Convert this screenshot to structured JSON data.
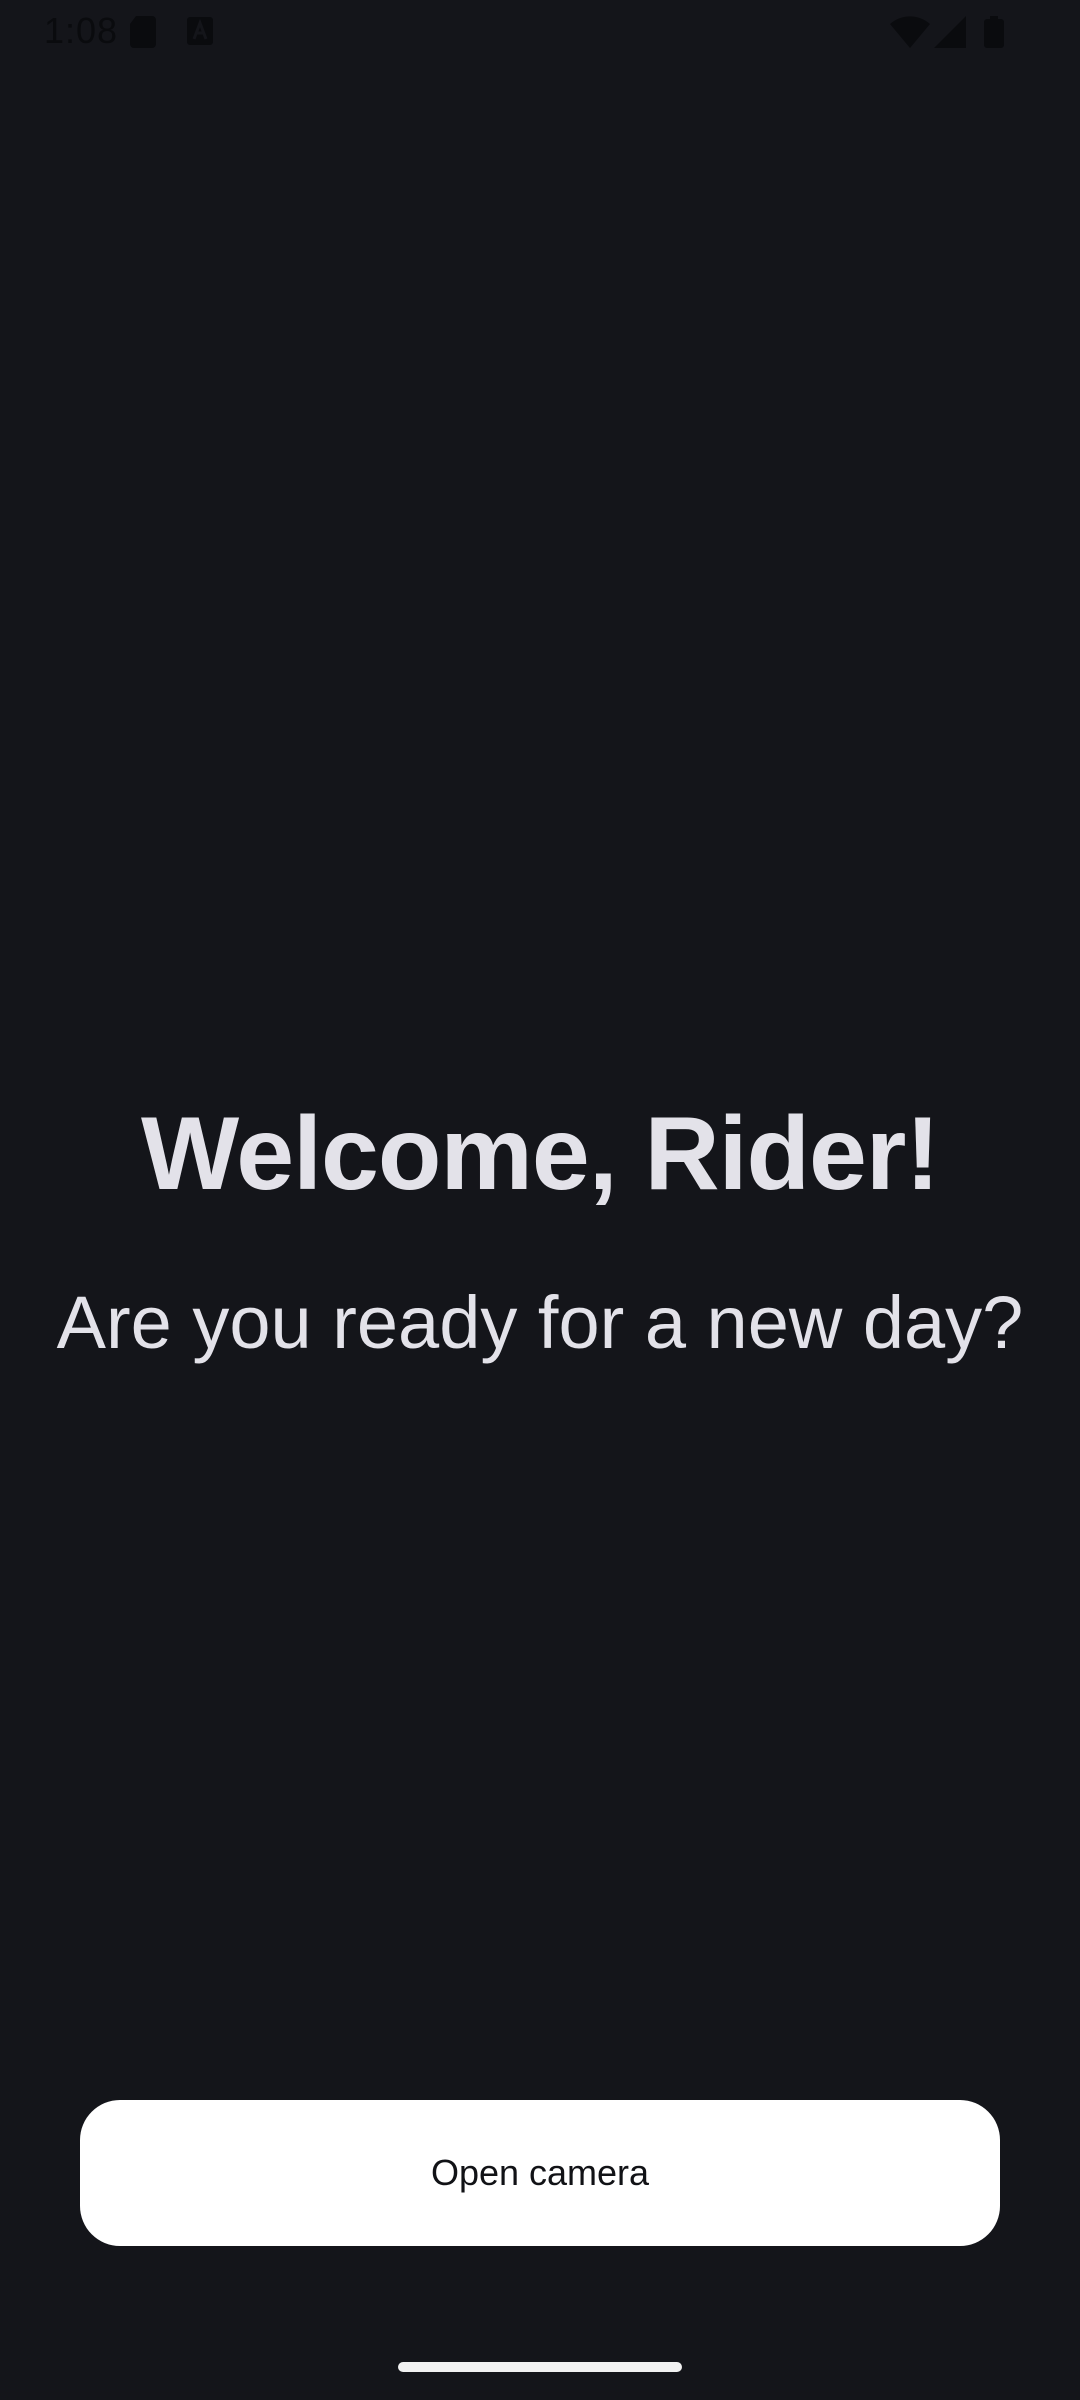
{
  "status_bar": {
    "time": "1:08",
    "icons": [
      "sim-card-icon",
      "app-notification-icon",
      "wifi-icon",
      "cellular-signal-icon",
      "battery-icon"
    ]
  },
  "welcome": {
    "title": "Welcome, Rider!",
    "subtitle": "Are you ready for a new day?"
  },
  "actions": {
    "open_camera_label": "Open camera"
  },
  "colors": {
    "background": "#14151a",
    "text": "#e3e2e9",
    "button_bg": "#ffffff",
    "button_text": "#111216"
  }
}
